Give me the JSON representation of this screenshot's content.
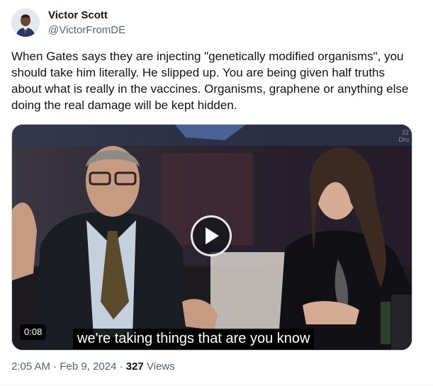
{
  "author": {
    "display_name": "Victor Scott",
    "handle": "@VictorFromDE"
  },
  "tweet": {
    "text": "When Gates says they are injecting \"genetically modified organisms\", you should take him literally. He slipped up. You are being given half truths about what is really in the vaccines. Organisms, graphene or anything else doing the real damage will be kept hidden."
  },
  "video": {
    "duration": "0:08",
    "subtitle": "we're taking things that are you know",
    "corner_text_1": "22",
    "corner_text_2": "Dru",
    "play_icon": "play-icon"
  },
  "meta": {
    "time": "2:05 AM",
    "separator": "·",
    "date": "Feb 9, 2024",
    "views_count": "327",
    "views_label": "Views"
  },
  "colors": {
    "text_primary": "#0f1419",
    "text_secondary": "#536471",
    "border": "#cfd9de"
  }
}
